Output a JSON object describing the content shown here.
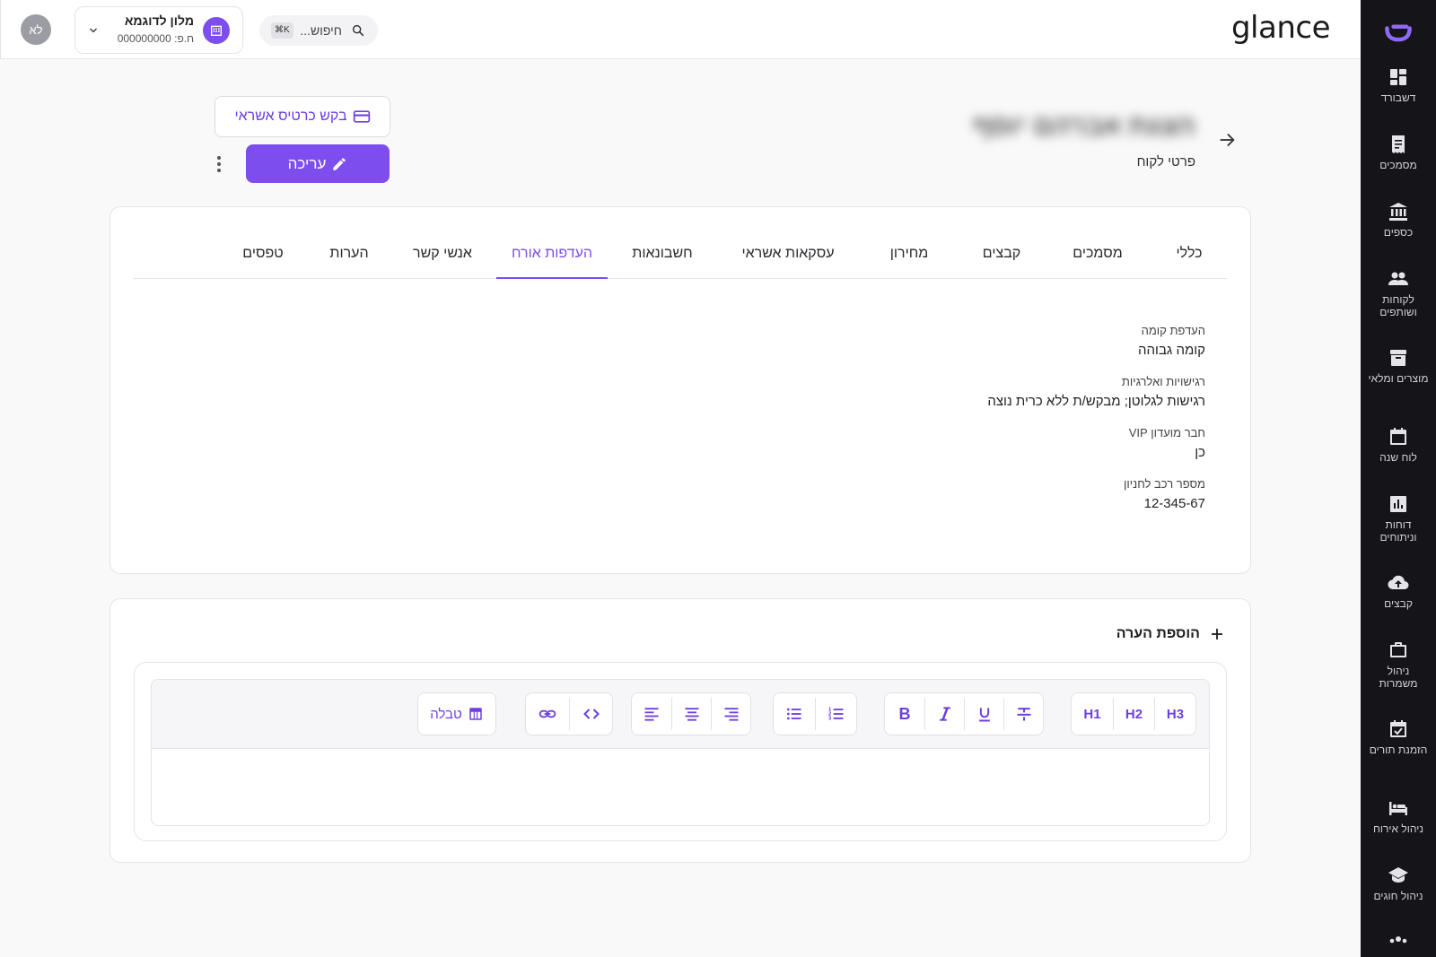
{
  "brand": "glance",
  "user": {
    "initials": "לא"
  },
  "hotel": {
    "name": "מלון לדוגמא",
    "phone": "ח.פ: 000000000"
  },
  "search": {
    "placeholder": "חיפוש...",
    "shortcut": "⌘K"
  },
  "sidebar": {
    "items": [
      {
        "label": "דשבורד",
        "icon": "dashboard-icon"
      },
      {
        "label": "מסמכים",
        "icon": "documents-icon"
      },
      {
        "label": "כספים",
        "icon": "bank-icon"
      },
      {
        "label": "לקוחות ושותפים",
        "icon": "people-icon"
      },
      {
        "label": "מוצרים ומלאי",
        "icon": "archive-icon"
      },
      {
        "label": "לוח שנה",
        "icon": "calendar-icon"
      },
      {
        "label": "דוחות וניתוחים",
        "icon": "chart-icon"
      },
      {
        "label": "קבצים",
        "icon": "cloud-upload-icon"
      },
      {
        "label": "ניהול משמרות",
        "icon": "briefcase-icon"
      },
      {
        "label": "הזמנת תורים",
        "icon": "calendar-check-icon"
      },
      {
        "label": "ניהול אירוח",
        "icon": "bed-icon"
      },
      {
        "label": "ניהול חוגים",
        "icon": "school-icon"
      }
    ]
  },
  "header": {
    "customer_name": "הצגת אברהם יוסף",
    "subtitle": "פרטי לקוח"
  },
  "actions": {
    "request_card": "בקש כרטיס אשראי",
    "edit": "עריכה"
  },
  "tabs": [
    {
      "label": "כללי"
    },
    {
      "label": "מסמכים"
    },
    {
      "label": "קבצים"
    },
    {
      "label": "מחירון"
    },
    {
      "label": "עסקאות אשראי"
    },
    {
      "label": "חשבונאות"
    },
    {
      "label": "העדפות אורח"
    },
    {
      "label": "אנשי קשר"
    },
    {
      "label": "הערות"
    },
    {
      "label": "טפסים"
    }
  ],
  "active_tab": "העדפות אורח",
  "preferences": [
    {
      "label": "העדפת קומה",
      "value": "קומה גבוהה"
    },
    {
      "label": "רגישויות ואלרגיות",
      "value": "רגישות לגלוטן; מבקש/ת ללא כרית נוצה"
    },
    {
      "label": "חבר מועדון VIP",
      "value": "כן"
    },
    {
      "label": "מספר רכב לחניון",
      "value": "12-345-67"
    }
  ],
  "notes": {
    "add_label": "הוספת הערה",
    "toolbar": {
      "h1": "H1",
      "h2": "H2",
      "h3": "H3",
      "bold": "B",
      "table": "טבלה"
    }
  },
  "colors": {
    "accent": "#7d4dee",
    "sidebar_bg": "#151419"
  }
}
